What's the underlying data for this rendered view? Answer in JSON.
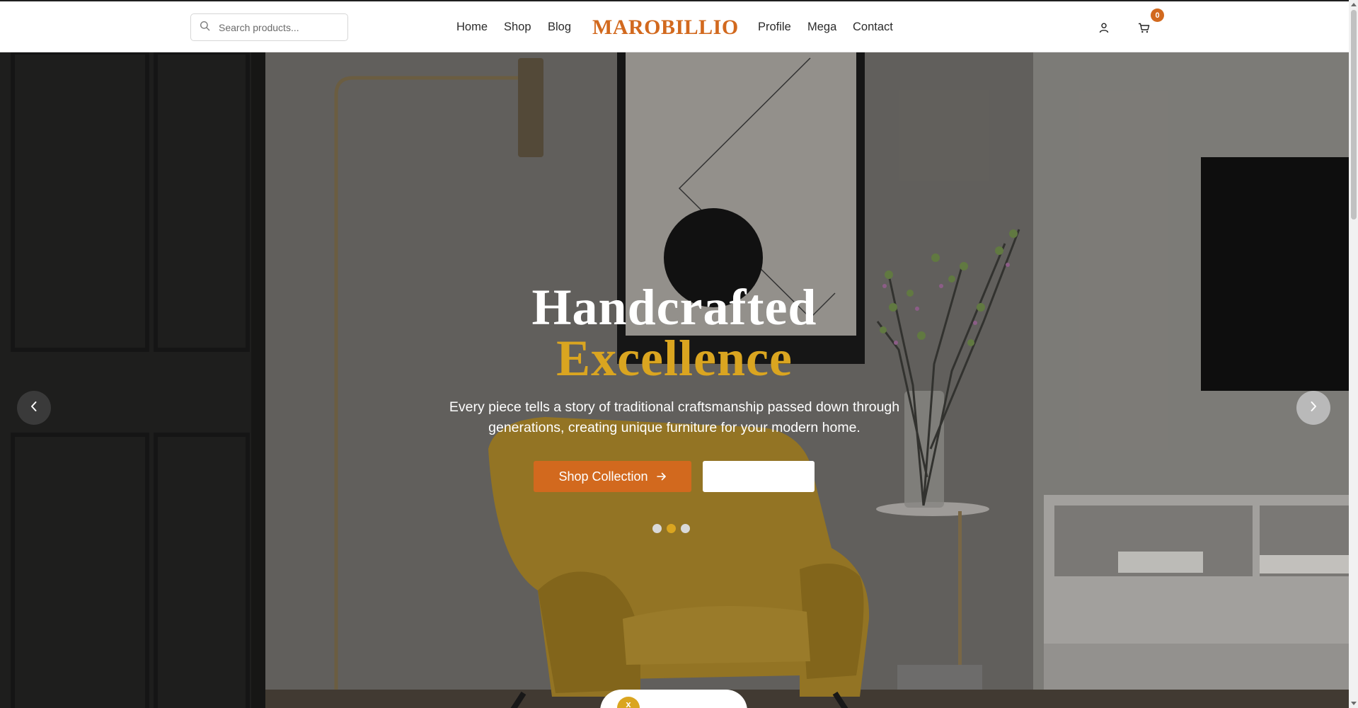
{
  "search": {
    "placeholder": "Search products..."
  },
  "nav": {
    "left": [
      "Home",
      "Shop",
      "Blog"
    ],
    "right": [
      "Profile",
      "Mega",
      "Contact"
    ]
  },
  "brand": {
    "name": "MAROBILLIO"
  },
  "cart": {
    "count": "0"
  },
  "icons": {
    "search": "search-icon",
    "user": "user-icon",
    "cart": "cart-icon",
    "prev": "chevron-left-icon",
    "next": "chevron-right-icon",
    "cta_arrow": "arrow-right-icon"
  },
  "hero": {
    "title_line1": "Handcrafted",
    "title_line2": "Excellence",
    "subtitle": "Every piece tells a story of traditional craftsmanship passed down through generations, creating unique furniture for your modern home.",
    "primary_cta": "Shop Collection",
    "secondary_cta": "",
    "slides_total": 3,
    "active_slide": 2,
    "pill_icon_text": "x"
  },
  "colors": {
    "brand": "#d2691e",
    "accent_gold": "#daa520",
    "cta": "#d2691e",
    "badge": "#d2691e",
    "title_white": "#ffffff",
    "dot_inactive": "#d9d9d9",
    "dot_active": "#daa520",
    "arrow_left_bg": "#3a3a3a",
    "arrow_right_bg": "#b9b9b9",
    "pill_icon": "#daa520"
  }
}
